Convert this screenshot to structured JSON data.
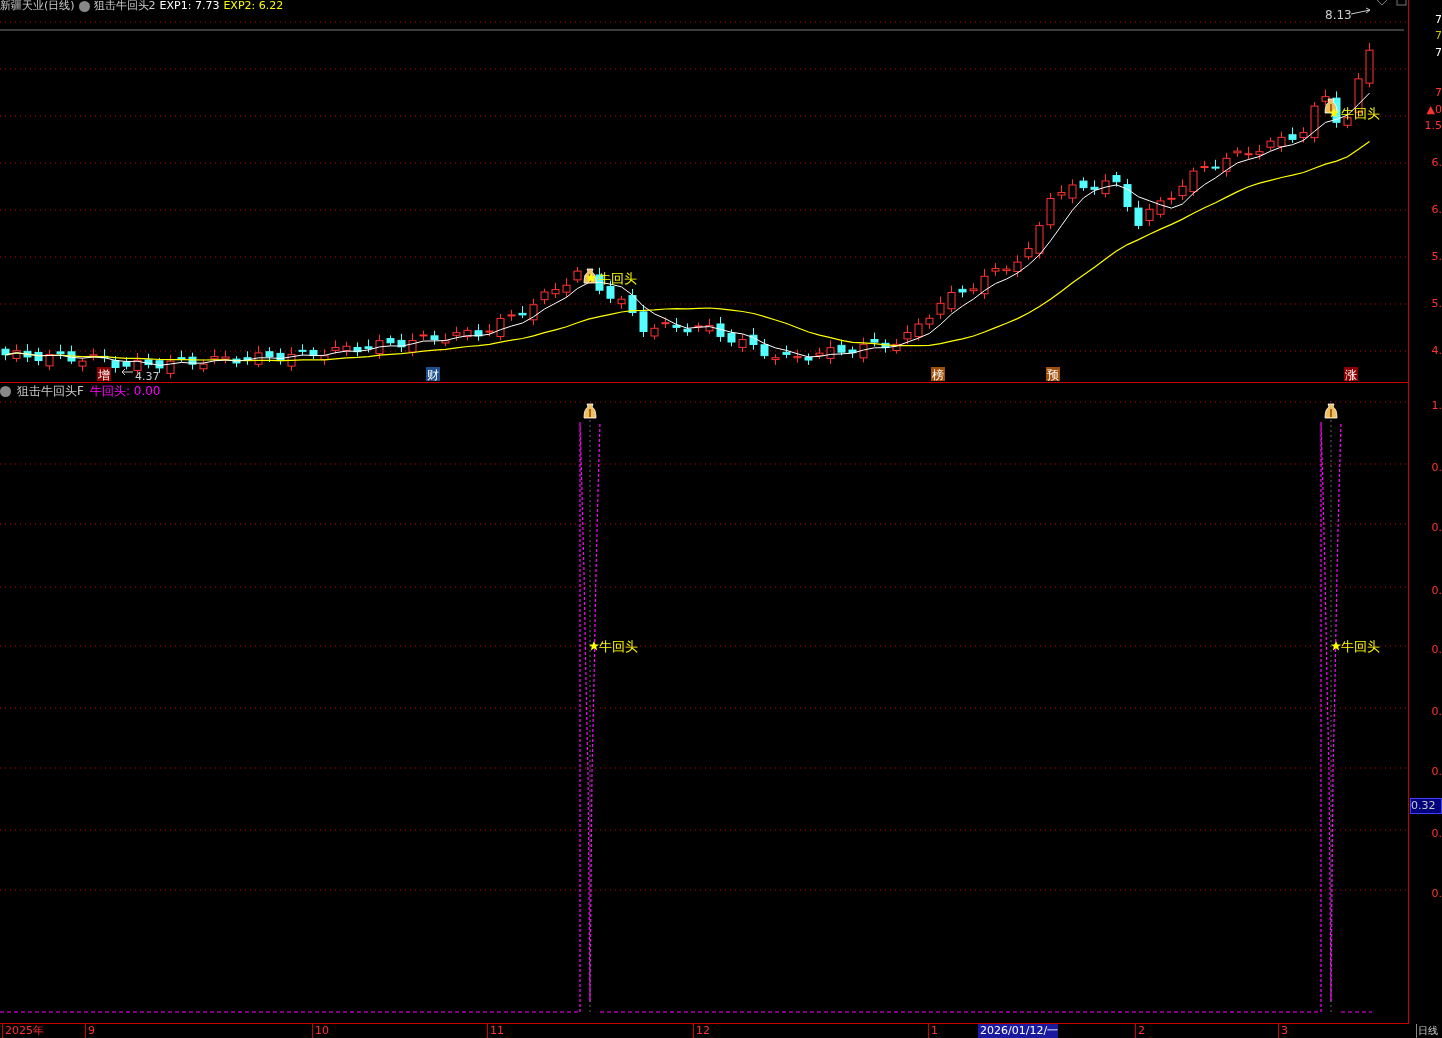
{
  "main_panel": {
    "title": "新疆天业(日线)",
    "indicator": "狙击牛回头2",
    "values": [
      {
        "label": "EXP1: 7.73",
        "color": "#ffffff"
      },
      {
        "label": "EXP2: 6.22",
        "color": "#ffff00"
      }
    ],
    "high_label": "8.13",
    "low_label": "4.37",
    "signals": [
      "牛回头",
      "牛回头"
    ],
    "badges": [
      {
        "text": "增",
        "color": "#8b0000"
      },
      {
        "text": "财",
        "color": "#1f4e8c"
      },
      {
        "text": "榜",
        "color": "#a0500a"
      },
      {
        "text": "预",
        "color": "#a0500a"
      },
      {
        "text": "涨",
        "color": "#8b0000"
      }
    ],
    "axis_labels": [
      {
        "text": "7",
        "color": "#ffffff"
      },
      {
        "text": "7",
        "color": "#c8c800"
      },
      {
        "text": "7",
        "color": "#ffffff"
      },
      {
        "text": "7",
        "color": "#ff3232"
      },
      {
        "text": "▲0",
        "color": "#ff3232"
      },
      {
        "text": "1.5",
        "color": "#ff3232"
      },
      {
        "text": "6.",
        "color": "#ff3232"
      },
      {
        "text": "6.",
        "color": "#ff3232"
      },
      {
        "text": "5.",
        "color": "#ff3232"
      },
      {
        "text": "5.",
        "color": "#ff3232"
      },
      {
        "text": "4.",
        "color": "#ff3232"
      }
    ]
  },
  "sub_panel": {
    "indicator": "狙击牛回头F",
    "value": "牛回头: 0.00",
    "signals": [
      "牛回头",
      "牛回头"
    ],
    "axis_labels": [
      "1.",
      "0.",
      "0.",
      "0.",
      "0.",
      "0.",
      "0.",
      "0.",
      "0."
    ],
    "current": "0.32"
  },
  "time_axis": {
    "labels": [
      "2025年",
      "9",
      "10",
      "11",
      "12",
      "1"
    ],
    "cursor": "2026/01/12/一",
    "labels_after": [
      "2",
      "3"
    ],
    "period": "日线"
  }
}
